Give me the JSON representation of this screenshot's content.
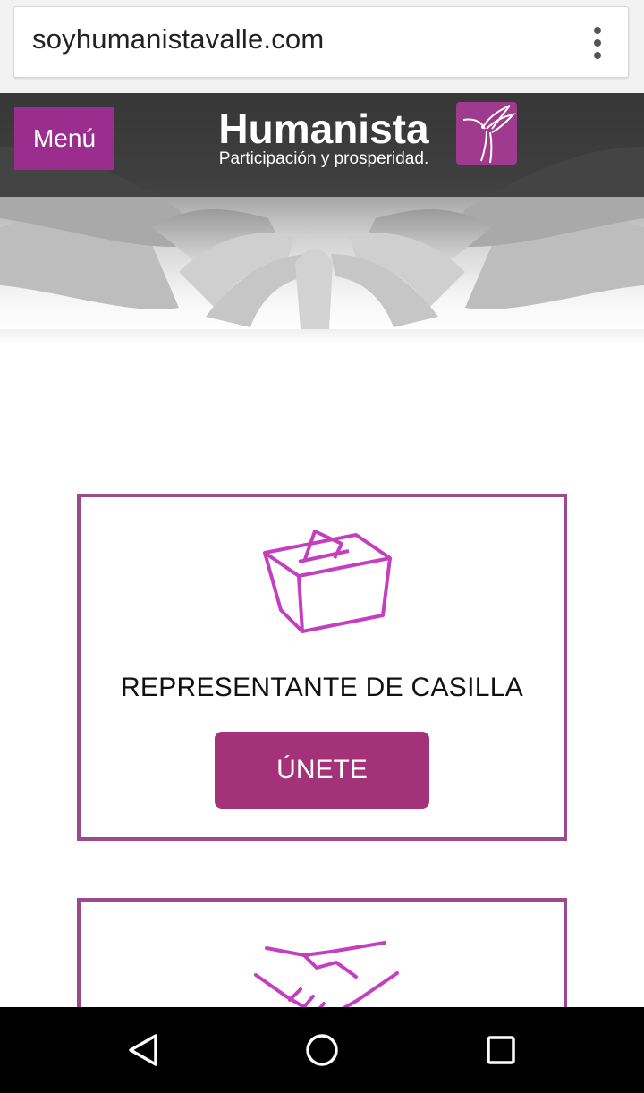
{
  "browser": {
    "url": "soyhumanistavalle.com"
  },
  "header": {
    "menu_label": "Menú",
    "brand_title": "Humanista",
    "brand_tagline": "Participación y prosperidad."
  },
  "cards": [
    {
      "icon": "ballot-box-icon",
      "title": "REPRESENTANTE DE CASILLA",
      "button_label": "ÚNETE"
    },
    {
      "icon": "handshake-icon"
    }
  ],
  "colors": {
    "accent": "#9b2d8f",
    "button": "#a33278",
    "card_border": "#9b4a8f",
    "icon_stroke": "#c43fbf"
  },
  "android_nav": {
    "back_icon": "back-triangle-icon",
    "home_icon": "home-circle-icon",
    "recents_icon": "recents-square-icon"
  }
}
